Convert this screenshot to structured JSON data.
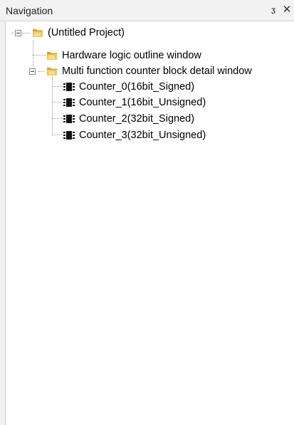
{
  "panel": {
    "title": "Navigation",
    "pin_icon": "pin-icon",
    "close_icon": "close-icon"
  },
  "tree": {
    "root": {
      "label": "(Untitled Project)",
      "icon": "folder-icon",
      "expanded": true
    },
    "children": [
      {
        "label": "Hardware logic outline window",
        "icon": "folder-icon",
        "expanded": false
      },
      {
        "label": "Multi function counter block detail window",
        "icon": "folder-icon",
        "expanded": true,
        "children": [
          {
            "label": "Counter_0(16bit_Signed)",
            "icon": "chip-icon"
          },
          {
            "label": "Counter_1(16bit_Unsigned)",
            "icon": "chip-icon"
          },
          {
            "label": "Counter_2(32bit_Signed)",
            "icon": "chip-icon"
          },
          {
            "label": "Counter_3(32bit_Unsigned)",
            "icon": "chip-icon"
          }
        ]
      }
    ]
  },
  "colors": {
    "titlebar_bg": "#f2f2f2",
    "folder": "#e8b54a",
    "chip": "#111111"
  }
}
